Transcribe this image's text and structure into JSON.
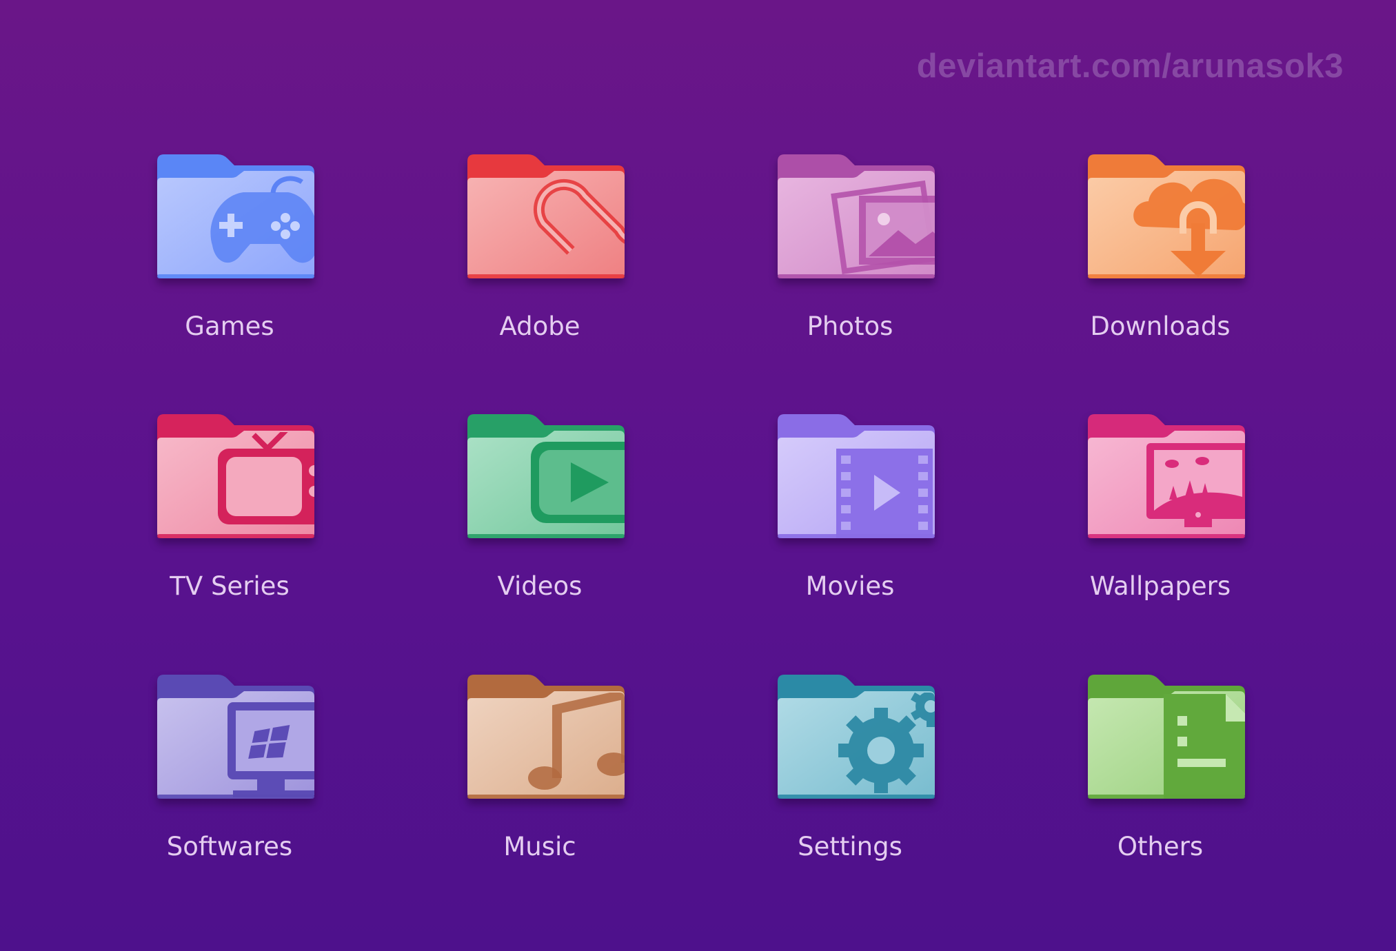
{
  "watermark": "deviantart.com/arunasok3",
  "folders": [
    {
      "label": "Games",
      "icon": "gamepad-icon",
      "tab": "#5a86f6",
      "body_top": "#b9c8fd",
      "body_bottom": "#8ea6fc",
      "accent": "#5b82f5"
    },
    {
      "label": "Adobe",
      "icon": "creative-cloud-icon",
      "tab": "#e7393e",
      "body_top": "#f7b3b3",
      "body_bottom": "#ef8082",
      "accent": "#e53a3c"
    },
    {
      "label": "Photos",
      "icon": "photos-icon",
      "tab": "#ad4fa8",
      "body_top": "#e8b6e0",
      "body_bottom": "#d18ac8",
      "accent": "#b452ab"
    },
    {
      "label": "Downloads",
      "icon": "cloud-download-icon",
      "tab": "#ef7b39",
      "body_top": "#fbcca8",
      "body_bottom": "#f6a570",
      "accent": "#f07b37"
    },
    {
      "label": "TV Series",
      "icon": "tv-icon",
      "tab": "#d6235c",
      "body_top": "#f7b9c9",
      "body_bottom": "#ee8aa5",
      "accent": "#d4225b"
    },
    {
      "label": "Videos",
      "icon": "play-video-icon",
      "tab": "#27a067",
      "body_top": "#abe1c6",
      "body_bottom": "#72c79c",
      "accent": "#1f9b5f"
    },
    {
      "label": "Movies",
      "icon": "film-strip-icon",
      "tab": "#8a6de6",
      "body_top": "#d6ccfb",
      "body_bottom": "#b4a3f4",
      "accent": "#8c70e8"
    },
    {
      "label": "Wallpapers",
      "icon": "landscape-monitor-icon",
      "tab": "#d62a7a",
      "body_top": "#f7b8d3",
      "body_bottom": "#ee87b4",
      "accent": "#d92c7b"
    },
    {
      "label": "Softwares",
      "icon": "windows-monitor-icon",
      "tab": "#5a4ab4",
      "body_top": "#c8c2ee",
      "body_bottom": "#9e93dc",
      "accent": "#5c4cb6"
    },
    {
      "label": "Music",
      "icon": "music-note-icon",
      "tab": "#b26a3e",
      "body_top": "#efd3c0",
      "body_bottom": "#dcae8d",
      "accent": "#b26a3f"
    },
    {
      "label": "Settings",
      "icon": "gear-icon",
      "tab": "#2b8aa6",
      "body_top": "#b1dbe6",
      "body_bottom": "#78bccf",
      "accent": "#2e8aa5"
    },
    {
      "label": "Others",
      "icon": "document-icon",
      "tab": "#5fa63a",
      "body_top": "#c6e8b2",
      "body_bottom": "#99cf7c",
      "accent": "#61a93c"
    }
  ]
}
